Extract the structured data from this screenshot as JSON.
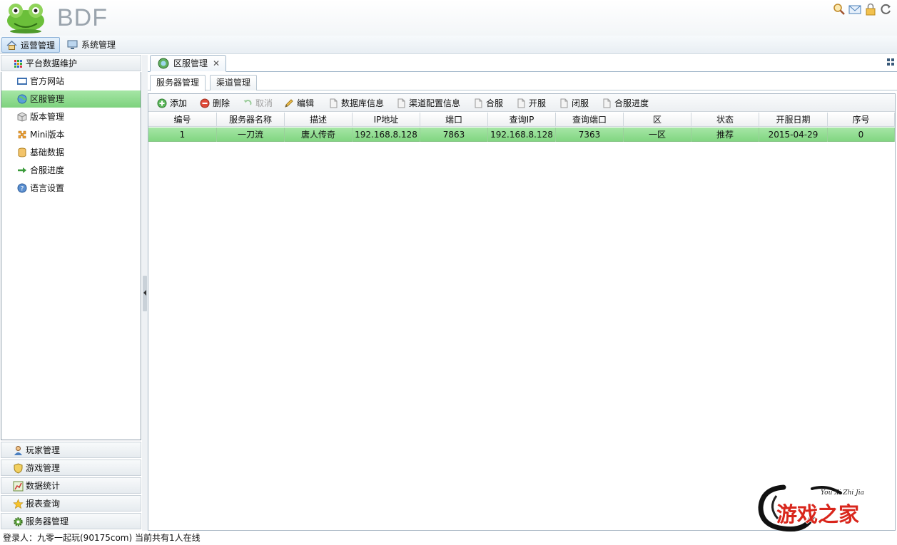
{
  "app": {
    "logo_text": "BDF"
  },
  "menubar": {
    "items": [
      {
        "label": "运营管理",
        "icon": "home-icon",
        "active": true
      },
      {
        "label": "系统管理",
        "icon": "monitor-icon",
        "active": false
      }
    ]
  },
  "sidebar": {
    "sections": [
      {
        "label": "平台数据维护",
        "icon": "grid-dots-icon"
      },
      {
        "label": "玩家管理",
        "icon": "user-icon"
      },
      {
        "label": "游戏管理",
        "icon": "shield-icon"
      },
      {
        "label": "数据统计",
        "icon": "chart-icon"
      },
      {
        "label": "报表查询",
        "icon": "star-icon"
      },
      {
        "label": "服务器管理",
        "icon": "gear-icon"
      }
    ],
    "items": [
      {
        "label": "官方网站",
        "icon": "html-icon"
      },
      {
        "label": "区服管理",
        "icon": "globe-icon",
        "selected": true
      },
      {
        "label": "版本管理",
        "icon": "box-icon"
      },
      {
        "label": "Mini版本",
        "icon": "puzzle-icon"
      },
      {
        "label": "基础数据",
        "icon": "database-icon"
      },
      {
        "label": "合服进度",
        "icon": "arrow-right-icon"
      },
      {
        "label": "语言设置",
        "icon": "help-icon"
      }
    ]
  },
  "main": {
    "tab": {
      "label": "区服管理",
      "close": "✕"
    },
    "subtabs": [
      {
        "label": "服务器管理",
        "active": true
      },
      {
        "label": "渠道管理",
        "active": false
      }
    ],
    "toolbar": [
      {
        "label": "添加",
        "icon": "add-icon",
        "enabled": true
      },
      {
        "label": "删除",
        "icon": "delete-icon",
        "enabled": true
      },
      {
        "label": "取消",
        "icon": "undo-icon",
        "enabled": false
      },
      {
        "label": "编辑",
        "icon": "pencil-icon",
        "enabled": true
      },
      {
        "label": "数据库信息",
        "icon": "page-icon",
        "enabled": true
      },
      {
        "label": "渠道配置信息",
        "icon": "page-icon",
        "enabled": true
      },
      {
        "label": "合服",
        "icon": "page-icon",
        "enabled": true
      },
      {
        "label": "开服",
        "icon": "page-icon",
        "enabled": true
      },
      {
        "label": "闭服",
        "icon": "page-icon",
        "enabled": true
      },
      {
        "label": "合服进度",
        "icon": "page-icon",
        "enabled": true
      }
    ],
    "table": {
      "columns": [
        "编号",
        "服务器名称",
        "描述",
        "IP地址",
        "端口",
        "查询IP",
        "查询端口",
        "区",
        "状态",
        "开服日期",
        "序号"
      ],
      "rows": [
        [
          "1",
          "一刀流",
          "唐人传奇",
          "192.168.8.128",
          "7863",
          "192.168.8.128",
          "7363",
          "一区",
          "推荐",
          "2015-04-29",
          "0"
        ]
      ]
    }
  },
  "status": {
    "text": "登录人：九零一起玩(90175com)    当前共有1人在线"
  },
  "watermark": {
    "title": "游戏之家",
    "subtitle": "You Xi Zhi Jia"
  },
  "colors": {
    "selection": "#8fdc8f",
    "accent": "#3a7fc0",
    "watermark_red": "#d9261c"
  }
}
